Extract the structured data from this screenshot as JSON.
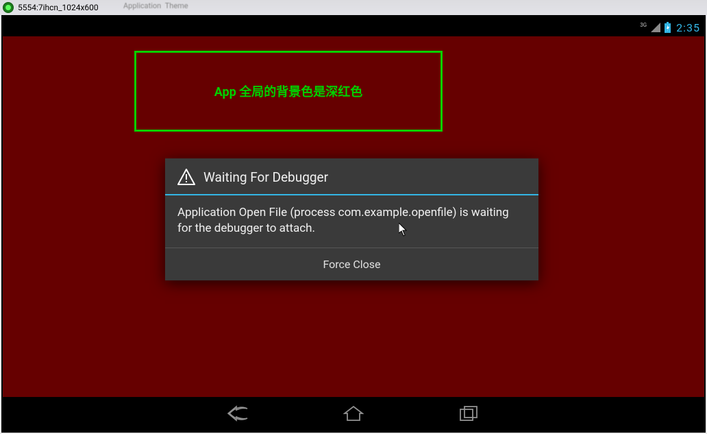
{
  "window": {
    "title": "5554:7ihcn_1024x600"
  },
  "status_bar": {
    "network_label": "3G",
    "battery_indicator": "battery",
    "signal_indicator": "signal",
    "clock": "2:35"
  },
  "annotation": {
    "text": "App 全局的背景色是深红色"
  },
  "dialog": {
    "title": "Waiting For Debugger",
    "message": "Application Open File (process com.example.openfile) is waiting for the debugger to attach.",
    "button": "Force Close",
    "icon": "warning-triangle"
  },
  "nav": {
    "back": "back",
    "home": "home",
    "recents": "recents"
  },
  "colors": {
    "app_background": "#660000",
    "annotation_green": "#00d000",
    "holo_blue": "#33b5e5"
  }
}
